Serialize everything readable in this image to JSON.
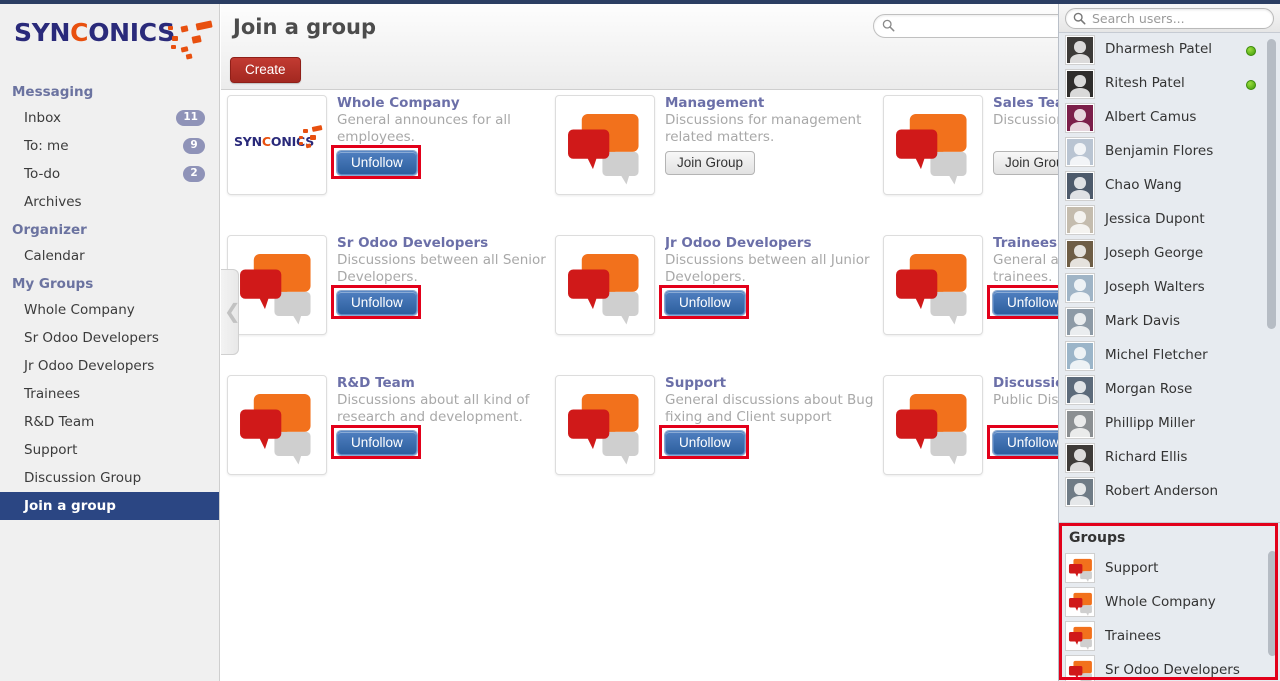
{
  "brand": {
    "name_part1": "SYN",
    "name_part2": "C",
    "name_part3": "ONICS",
    "logo_icon": "syncomics-logo-dots"
  },
  "sidebar": {
    "sections": [
      {
        "label": "Messaging",
        "items": [
          {
            "label": "Inbox",
            "badge": "11"
          },
          {
            "label": "To: me",
            "badge": "9"
          },
          {
            "label": "To-do",
            "badge": "2"
          },
          {
            "label": "Archives",
            "badge": ""
          }
        ]
      },
      {
        "label": "Organizer",
        "items": [
          {
            "label": "Calendar",
            "badge": ""
          }
        ]
      },
      {
        "label": "My Groups",
        "items": [
          {
            "label": "Whole Company",
            "badge": ""
          },
          {
            "label": "Sr Odoo Developers",
            "badge": ""
          },
          {
            "label": "Jr Odoo Developers",
            "badge": ""
          },
          {
            "label": "Trainees",
            "badge": ""
          },
          {
            "label": "R&D Team",
            "badge": ""
          },
          {
            "label": "Support",
            "badge": ""
          },
          {
            "label": "Discussion Group",
            "badge": ""
          },
          {
            "label": "Join a group",
            "badge": "",
            "active": true
          }
        ]
      }
    ]
  },
  "header": {
    "title": "Join a group",
    "create_label": "Create",
    "search_placeholder": "",
    "search_value": "",
    "search_icon": "search-icon"
  },
  "groups_grid": [
    {
      "title": "Whole Company",
      "description": "General announces for all employees.",
      "action_label": "Unfollow",
      "action_type": "unfollow",
      "highlighted": true,
      "thumb": "logo"
    },
    {
      "title": "Management",
      "description": "Discussions for management related matters.",
      "action_label": "Join Group",
      "action_type": "join",
      "highlighted": false,
      "thumb": "chat"
    },
    {
      "title": "Sales Team",
      "description": "Discussions about sales deals.",
      "action_label": "Join Group",
      "action_type": "join",
      "highlighted": false,
      "thumb": "chat"
    },
    {
      "title": "Sr Odoo Developers",
      "description": "Discussions between all Senior Developers.",
      "action_label": "Unfollow",
      "action_type": "unfollow",
      "highlighted": true,
      "thumb": "chat"
    },
    {
      "title": "Jr Odoo Developers",
      "description": "Discussions between all Junior Developers.",
      "action_label": "Unfollow",
      "action_type": "unfollow",
      "highlighted": true,
      "thumb": "chat"
    },
    {
      "title": "Trainees",
      "description": "General announces for all trainees.",
      "action_label": "Unfollow",
      "action_type": "unfollow",
      "highlighted": true,
      "thumb": "chat"
    },
    {
      "title": "R&D Team",
      "description": "Discussions about all kind of research and development.",
      "action_label": "Unfollow",
      "action_type": "unfollow",
      "highlighted": true,
      "thumb": "chat"
    },
    {
      "title": "Support",
      "description": "General discussions about Bug fixing and Client support",
      "action_label": "Unfollow",
      "action_type": "unfollow",
      "highlighted": true,
      "thumb": "chat"
    },
    {
      "title": "Discussion Group",
      "description": "Public Discussion Group.",
      "action_label": "Unfollow",
      "action_type": "unfollow",
      "highlighted": true,
      "thumb": "chat"
    }
  ],
  "user_panel": {
    "search_placeholder": "Search users...",
    "search_value": "",
    "search_icon": "search-icon",
    "users": [
      {
        "name": "Dharmesh Patel",
        "online": true,
        "avatar_color": "#3c3a38"
      },
      {
        "name": "Ritesh Patel",
        "online": true,
        "avatar_color": "#2f2d2c"
      },
      {
        "name": "Albert Camus",
        "online": false,
        "avatar_color": "#7b1f4a"
      },
      {
        "name": "Benjamin Flores",
        "online": false,
        "avatar_color": "#b9c4d2"
      },
      {
        "name": "Chao Wang",
        "online": false,
        "avatar_color": "#4d5a6b"
      },
      {
        "name": "Jessica Dupont",
        "online": false,
        "avatar_color": "#c4bcae"
      },
      {
        "name": "Joseph George",
        "online": false,
        "avatar_color": "#6e5d45"
      },
      {
        "name": "Joseph Walters",
        "online": false,
        "avatar_color": "#9fb4c6"
      },
      {
        "name": "Mark Davis",
        "online": false,
        "avatar_color": "#8d9aa6"
      },
      {
        "name": "Michel Fletcher",
        "online": false,
        "avatar_color": "#9bb5c9"
      },
      {
        "name": "Morgan Rose",
        "online": false,
        "avatar_color": "#5c6a7a"
      },
      {
        "name": "Phillipp Miller",
        "online": false,
        "avatar_color": "#8b8f92"
      },
      {
        "name": "Richard Ellis",
        "online": false,
        "avatar_color": "#3e3b39"
      },
      {
        "name": "Robert Anderson",
        "online": false,
        "avatar_color": "#6f7b86"
      }
    ],
    "groups_title": "Groups",
    "groups": [
      {
        "name": "Support",
        "icon": "chat-bubbles-icon"
      },
      {
        "name": "Whole Company",
        "icon": "chat-bubbles-icon"
      },
      {
        "name": "Trainees",
        "icon": "chat-bubbles-icon"
      },
      {
        "name": "Sr Odoo Developers",
        "icon": "chat-bubbles-icon"
      }
    ],
    "groups_highlighted": true
  },
  "colors": {
    "accent_red": "#e2001a",
    "brand_blue": "#2a2a7a",
    "brand_orange": "#e8500f",
    "active_nav": "#2b4683",
    "follow_blue": "#2d5f9e",
    "online_green": "#4caf13"
  }
}
